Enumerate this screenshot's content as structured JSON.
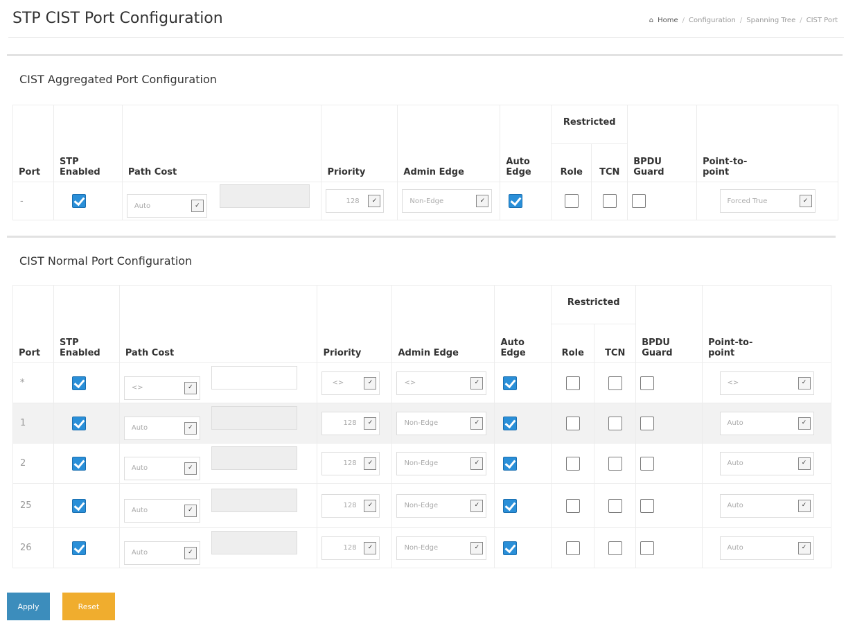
{
  "page": {
    "title": "STP CIST Port Configuration"
  },
  "breadcrumb": [
    "Home",
    "Configuration",
    "Spanning Tree",
    "CIST Port"
  ],
  "aggregated": {
    "title": "CIST Aggregated Port Configuration",
    "headers": {
      "port": "Port",
      "stp_enabled_1": "STP",
      "stp_enabled_2": "Enabled",
      "path_cost": "Path Cost",
      "priority": "Priority",
      "admin_edge": "Admin Edge",
      "auto_edge_1": "Auto",
      "auto_edge_2": "Edge",
      "restricted": "Restricted",
      "role": "Role",
      "tcn": "TCN",
      "bpdu_1": "BPDU",
      "bpdu_2": "Guard",
      "p2p_1": "Point-to-",
      "p2p_2": "point"
    },
    "row": {
      "port": "-",
      "stp_enabled": true,
      "path_cost": "Auto",
      "path_cost_value": "",
      "priority": "128",
      "admin_edge": "Non-Edge",
      "auto_edge": true,
      "role": false,
      "tcn": false,
      "bpdu_guard": false,
      "p2p": "Forced True"
    }
  },
  "normal": {
    "title": "CIST Normal Port Configuration",
    "headers": {
      "port": "Port",
      "stp_enabled_1": "STP",
      "stp_enabled_2": "Enabled",
      "path_cost": "Path Cost",
      "priority": "Priority",
      "admin_edge": "Admin Edge",
      "auto_edge_1": "Auto",
      "auto_edge_2": "Edge",
      "restricted": "Restricted",
      "role": "Role",
      "tcn": "TCN",
      "bpdu_1": "BPDU",
      "bpdu_2": "Guard",
      "p2p_1": "Point-to-",
      "p2p_2": "point"
    },
    "rows": [
      {
        "port": "*",
        "stp_enabled": true,
        "path_cost": "<>",
        "priority": "<>",
        "admin_edge": "<>",
        "auto_edge": true,
        "role": false,
        "tcn": false,
        "bpdu_guard": false,
        "p2p": "<>"
      },
      {
        "port": "1",
        "stp_enabled": true,
        "path_cost": "Auto",
        "priority": "128",
        "admin_edge": "Non-Edge",
        "auto_edge": true,
        "role": false,
        "tcn": false,
        "bpdu_guard": false,
        "p2p": "Auto"
      },
      {
        "port": "2",
        "stp_enabled": true,
        "path_cost": "Auto",
        "priority": "128",
        "admin_edge": "Non-Edge",
        "auto_edge": true,
        "role": false,
        "tcn": false,
        "bpdu_guard": false,
        "p2p": "Auto"
      },
      {
        "port": "25",
        "stp_enabled": true,
        "path_cost": "Auto",
        "priority": "128",
        "admin_edge": "Non-Edge",
        "auto_edge": true,
        "role": false,
        "tcn": false,
        "bpdu_guard": false,
        "p2p": "Auto"
      },
      {
        "port": "26",
        "stp_enabled": true,
        "path_cost": "Auto",
        "priority": "128",
        "admin_edge": "Non-Edge",
        "auto_edge": true,
        "role": false,
        "tcn": false,
        "bpdu_guard": false,
        "p2p": "Auto"
      }
    ]
  },
  "buttons": {
    "apply": "Apply",
    "reset": "Reset"
  },
  "colors": {
    "checkbox_on": "#2a8fd8",
    "apply": "#3c8dbc",
    "reset": "#f0ad2e"
  }
}
